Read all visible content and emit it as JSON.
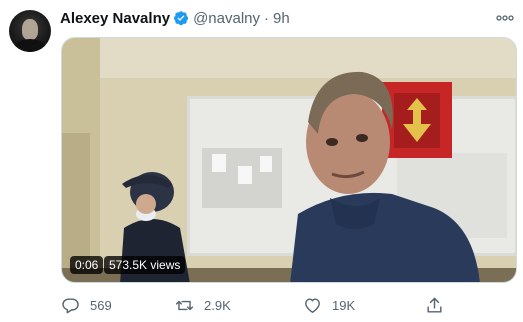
{
  "tweet": {
    "author_name": "Alexey Navalny",
    "handle": "@navalny",
    "separator": "·",
    "timestamp": "9h",
    "verified": true
  },
  "video": {
    "duration": "0:06",
    "views": "573.5K views"
  },
  "actions": {
    "replies": "569",
    "retweets": "2.9K",
    "likes": "19K"
  },
  "colors": {
    "accent": "#1d9bf0",
    "muted_text": "#536471",
    "text": "#0f1419"
  },
  "icons": [
    "verified-badge-icon",
    "more-icon",
    "reply-icon",
    "retweet-icon",
    "like-icon",
    "share-icon"
  ]
}
